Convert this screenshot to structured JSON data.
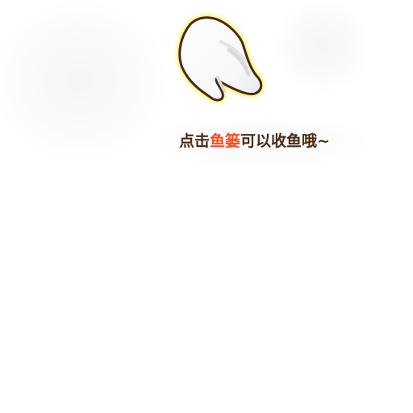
{
  "tutorial": {
    "hint_prefix": "点击",
    "hint_highlight": "鱼篓",
    "hint_suffix": "可以收鱼哦~"
  },
  "icons": {
    "pointer": "pointing-hand-icon"
  },
  "colors": {
    "text": "#4a2a12",
    "highlight": "#ff4a1c",
    "glow": "#f2e600",
    "hand_fill": "#ffffff",
    "hand_outline": "#4a2a12"
  }
}
